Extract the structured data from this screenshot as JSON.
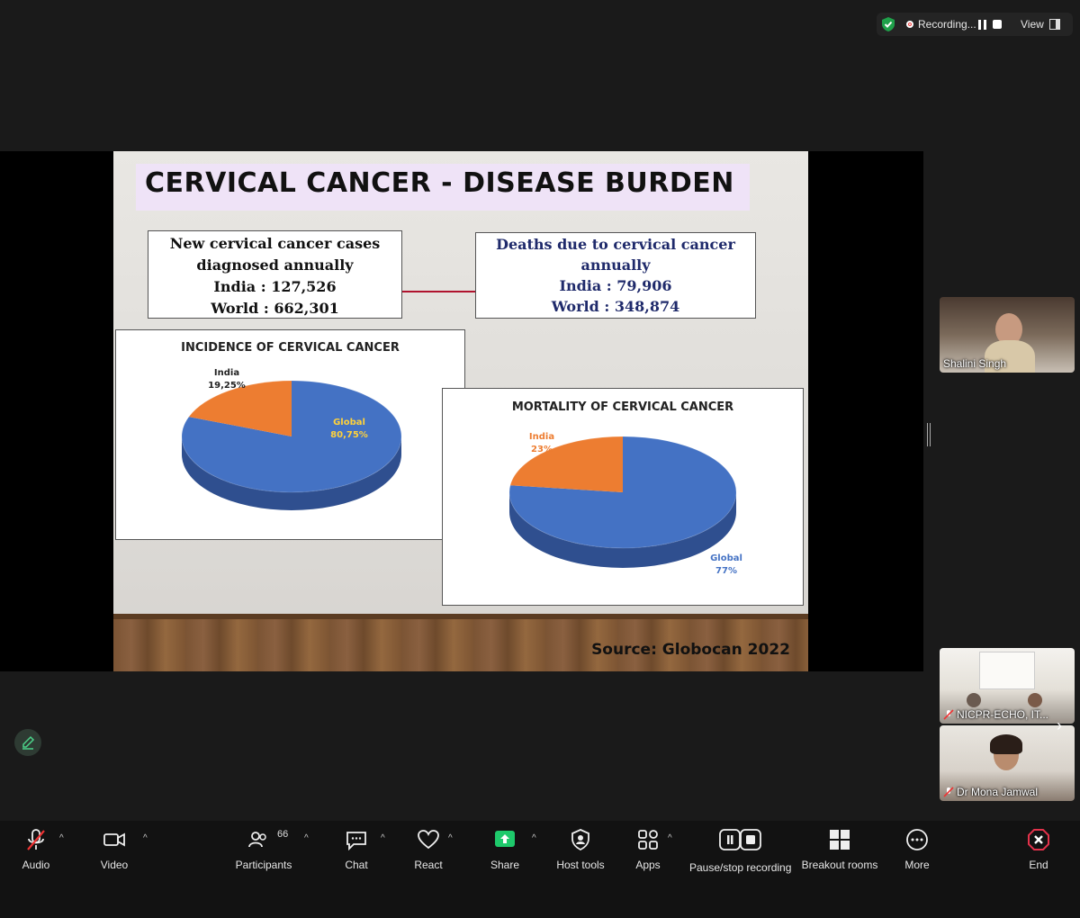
{
  "status": {
    "recording_label": "Recording...",
    "view_label": "View"
  },
  "slide": {
    "title": "CERVICAL CANCER - DISEASE BURDEN",
    "cases_box": {
      "line1": "New cervical cancer cases",
      "line2": "diagnosed annually",
      "india": "India : 127,526",
      "world": "World : 662,301"
    },
    "deaths_box": {
      "line1": "Deaths due to cervical cancer",
      "line2": "annually",
      "india": "India : 79,906",
      "world": "World : 348,874"
    },
    "source": "Source: Globocan 2022",
    "colors": {
      "global": "#4472c4",
      "india": "#ed7d31"
    }
  },
  "chart_data": [
    {
      "type": "pie",
      "title": "INCIDENCE OF CERVICAL CANCER",
      "categories": [
        "Global",
        "India"
      ],
      "values": [
        80.75,
        19.25
      ],
      "labels": {
        "india": "India",
        "india_value": "19,25%",
        "global": "Global",
        "global_value": "80,75%"
      }
    },
    {
      "type": "pie",
      "title": "MORTALITY OF CERVICAL CANCER",
      "categories": [
        "Global",
        "India"
      ],
      "values": [
        77,
        23
      ],
      "labels": {
        "india": "India",
        "india_value": "23%",
        "global": "Global",
        "global_value": "77%"
      }
    }
  ],
  "participants_tiles": [
    {
      "name": "Shalini Singh"
    },
    {
      "name": "NICPR-ECHO, IT..."
    },
    {
      "name": "Dr Mona Jamwal"
    }
  ],
  "toolbar": {
    "audio": "Audio",
    "video": "Video",
    "participants": "Participants",
    "participants_count": "66",
    "chat": "Chat",
    "react": "React",
    "share": "Share",
    "host_tools": "Host tools",
    "apps": "Apps",
    "pause_stop_recording": "Pause/stop recording",
    "breakout_rooms": "Breakout rooms",
    "more": "More",
    "end": "End"
  }
}
